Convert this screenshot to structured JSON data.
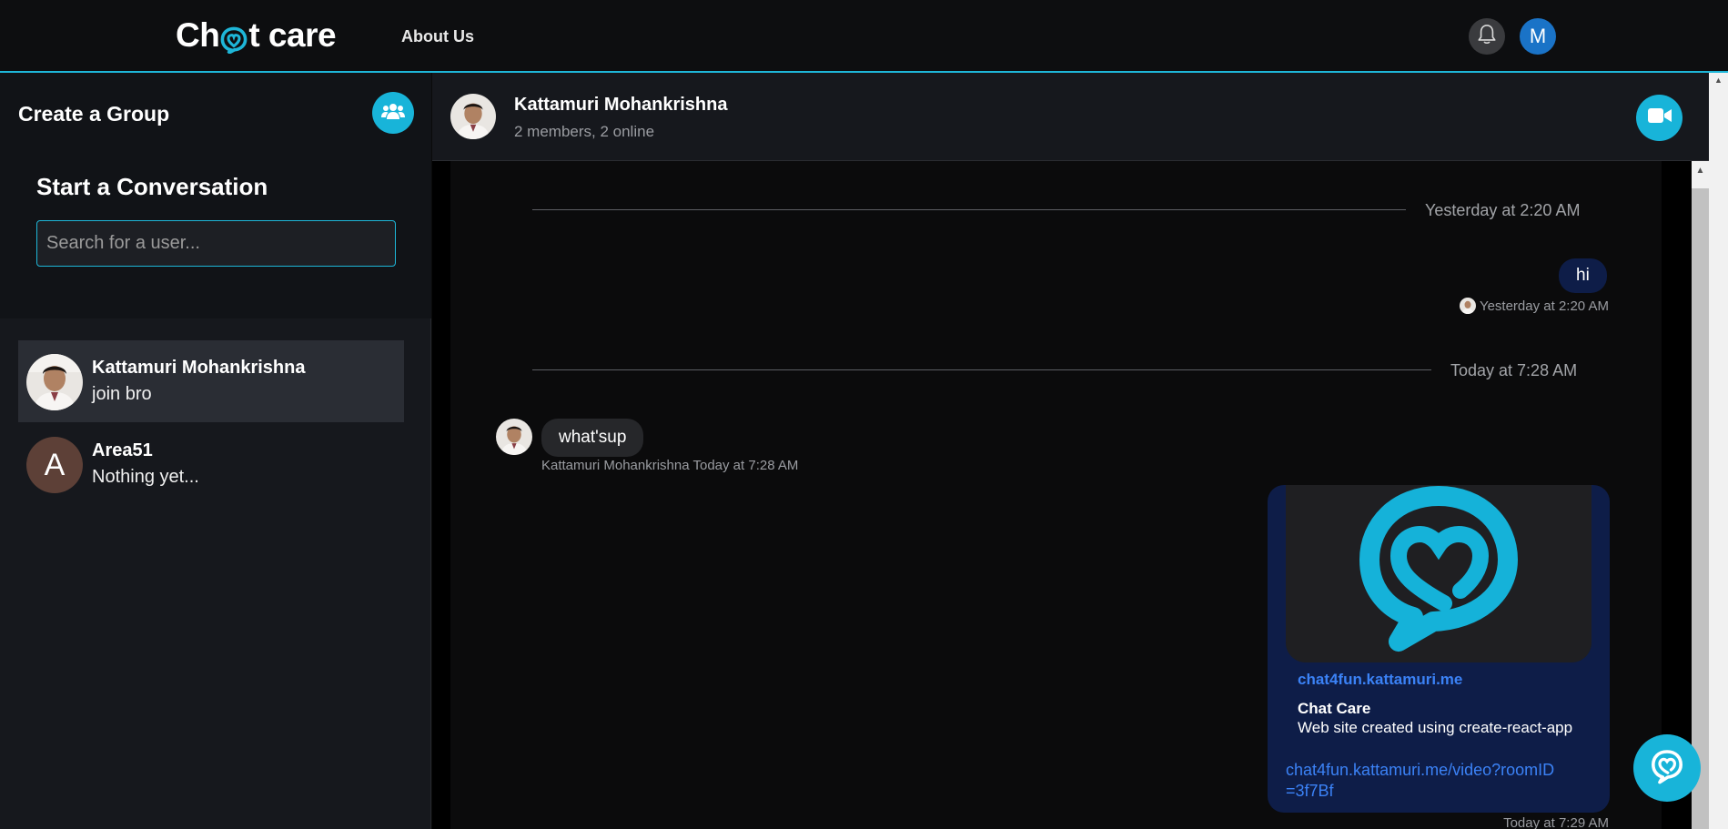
{
  "app": {
    "logo_prefix": "Ch",
    "logo_suffix": "t care",
    "logo_accent": "#1eb6d8"
  },
  "nav": {
    "about": "About Us",
    "user_initial": "M",
    "icons": [
      "bell-icon",
      "user-avatar"
    ]
  },
  "sidebar": {
    "create_group_label": "Create a Group",
    "start_title": "Start a Conversation",
    "search_placeholder": "Search for a user...",
    "conversations": [
      {
        "name": "Kattamuri Mohankrishna",
        "preview": "join bro",
        "avatar": "photo",
        "active": true
      },
      {
        "name": "Area51",
        "preview": "Nothing yet...",
        "avatar_letter": "A",
        "active": false
      }
    ]
  },
  "chat": {
    "title": "Kattamuri Mohankrishna",
    "subtitle": "2 members, 2 online",
    "messages": {
      "divider1": "Yesterday at 2:20 AM",
      "msg1_text": "hi",
      "msg1_meta": "Yesterday at 2:20 AM",
      "divider2": "Today at 7:28 AM",
      "msg2_text": "what'sup",
      "msg2_sender": "Kattamuri Mohankrishna",
      "msg2_time": "Today at 7:28 AM",
      "link_domain": "chat4fun.kattamuri.me",
      "link_title": "Chat Care",
      "link_desc": "Web site created using create-react-app",
      "link_url": "chat4fun.kattamuri.me/video?roomID=3f7Bf",
      "msg3_meta": "Today at 7:29 AM"
    }
  },
  "colors": {
    "accent": "#18b4d9",
    "outgoing_bubble": "#0e1d48",
    "incoming_bubble": "#26272a",
    "link": "#3b82f6"
  }
}
